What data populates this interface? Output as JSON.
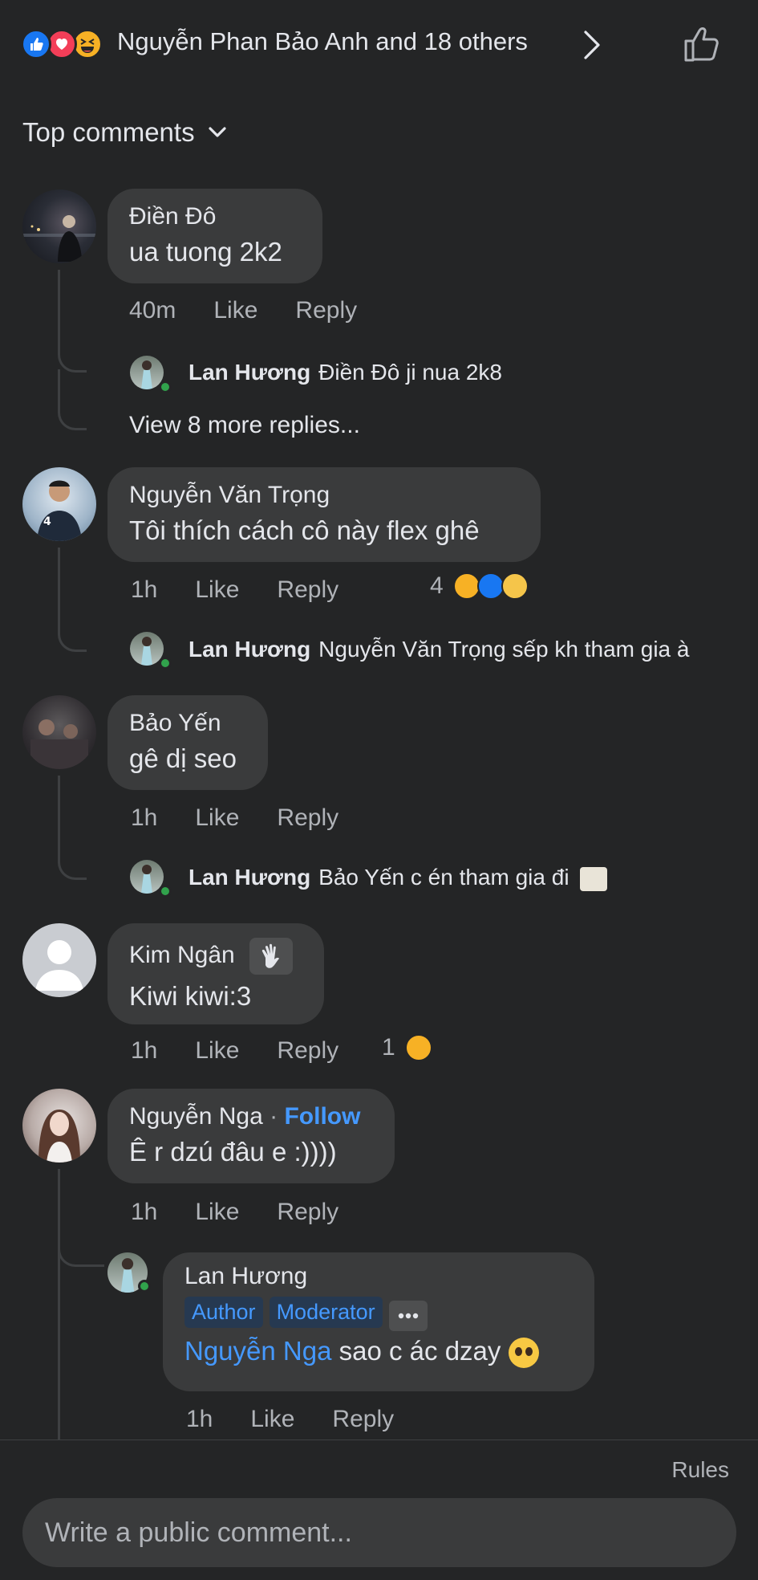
{
  "reactions": {
    "summary": "Nguyễn Phan Bảo Anh and 18 others",
    "icons": [
      "like-icon",
      "love-icon",
      "haha-icon"
    ]
  },
  "sort": {
    "label": "Top comments"
  },
  "comments": [
    {
      "name": "Điền Đô",
      "text": "ua tuong 2k2",
      "time": "40m",
      "like": "Like",
      "reply": "Reply",
      "replies": [
        {
          "name": "Lan Hương",
          "text": "Điền Đô ji nua 2k8"
        }
      ],
      "more_replies": "View 8 more replies..."
    },
    {
      "name": "Nguyễn Văn Trọng",
      "text": "Tôi thích cách cô này flex ghê",
      "time": "1h",
      "like": "Like",
      "reply": "Reply",
      "reaction_count": "4",
      "replies": [
        {
          "name": "Lan Hương",
          "text": "Nguyễn Văn Trọng sếp kh tham gia à"
        }
      ]
    },
    {
      "name": "Bảo Yến",
      "text": "gê dị seo",
      "time": "1h",
      "like": "Like",
      "reply": "Reply",
      "replies": [
        {
          "name": "Lan Hương",
          "text": "Bảo Yến c én tham gia đi"
        }
      ]
    },
    {
      "name": "Kim Ngân",
      "text": "Kiwi kiwi:3",
      "time": "1h",
      "like": "Like",
      "reply": "Reply",
      "reaction_count": "1"
    },
    {
      "name": "Nguyễn Nga",
      "follow": "Follow",
      "separator": "·",
      "text": "Ê r dzú đâu e :))))",
      "time": "1h",
      "like": "Like",
      "reply": "Reply",
      "replies": [
        {
          "name": "Lan Hương",
          "badges": [
            "Author",
            "Moderator"
          ],
          "mention": "Nguyễn Nga",
          "text": "sao c ác dzay",
          "time": "1h",
          "like": "Like",
          "reply": "Reply"
        }
      ]
    }
  ],
  "footer": {
    "rules": "Rules",
    "composer_placeholder": "Write a public comment..."
  },
  "colors": {
    "background": "#242526",
    "bubble": "#3a3b3c",
    "link": "#4599ff",
    "secondary_text": "#b0b3b8"
  }
}
